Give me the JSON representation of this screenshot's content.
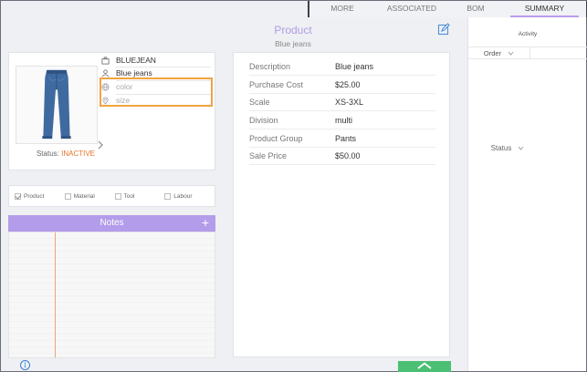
{
  "tabs": [
    "MORE",
    "ASSOCIATED",
    "BOM",
    "SUMMARY"
  ],
  "active_tab": "SUMMARY",
  "header": {
    "title": "Product",
    "subtitle": "Blue jeans"
  },
  "product": {
    "code": "BLUEJEAN",
    "name": "Blue jeans",
    "color_placeholder": "color",
    "size_placeholder": "size",
    "status_label": "Status:",
    "status_value": "INACTIVE"
  },
  "types": [
    {
      "label": "Product",
      "checked": true
    },
    {
      "label": "Material",
      "checked": false
    },
    {
      "label": "Tool",
      "checked": false
    },
    {
      "label": "Labour",
      "checked": false
    }
  ],
  "notes": {
    "title": "Notes",
    "add_label": "+"
  },
  "details": [
    {
      "key": "Description",
      "value": "Blue jeans"
    },
    {
      "key": "Purchase Cost",
      "value": "$25.00"
    },
    {
      "key": "Scale",
      "value": "XS-3XL"
    },
    {
      "key": "Division",
      "value": "multi"
    },
    {
      "key": "Product Group",
      "value": "Pants"
    },
    {
      "key": "Sale Price",
      "value": "$50.00"
    }
  ],
  "activity": {
    "title": "Activity",
    "col_order": "Order",
    "col_status": "Status"
  },
  "info_label": "i",
  "colors": {
    "accent": "#b39cea",
    "status_inactive": "#e8742b",
    "highlight": "#f2a340",
    "up_button": "#4bbf73"
  },
  "icons": [
    "edit-icon",
    "briefcase-icon",
    "user-icon",
    "globe-icon",
    "location-pin-icon",
    "chevron-right-icon",
    "plus-icon",
    "chevron-down-icon",
    "info-icon",
    "chevron-up-icon"
  ]
}
